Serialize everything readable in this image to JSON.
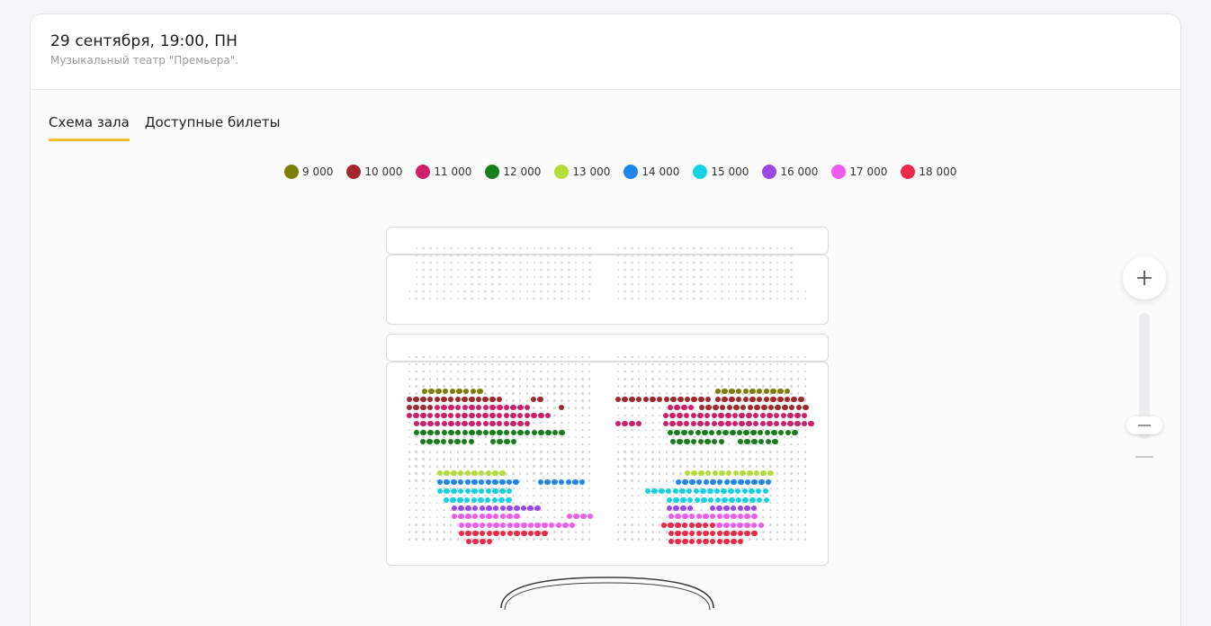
{
  "event": {
    "title": "29 сентября, 19:00, ПН",
    "venue": "Музыкальный театр \"Премьера\"."
  },
  "tabs": [
    {
      "label": "Схема зала",
      "active": true
    },
    {
      "label": "Доступные билеты",
      "active": false
    }
  ],
  "legend": [
    {
      "label": "9 000",
      "color": "#7d7d0a"
    },
    {
      "label": "10 000",
      "color": "#a3282c"
    },
    {
      "label": "11 000",
      "color": "#cf1f6a"
    },
    {
      "label": "12 000",
      "color": "#177e1b"
    },
    {
      "label": "13 000",
      "color": "#b3de3a"
    },
    {
      "label": "14 000",
      "color": "#1e86e8"
    },
    {
      "label": "15 000",
      "color": "#14d2e6"
    },
    {
      "label": "16 000",
      "color": "#9c47e6"
    },
    {
      "label": "17 000",
      "color": "#ef5bef"
    },
    {
      "label": "18 000",
      "color": "#e82a48"
    }
  ],
  "icons": {
    "zoom_in": "plus-icon",
    "zoom_out": "minus-icon",
    "slider": "slider-thumb"
  },
  "colors": {
    "accent": "#f5c029",
    "unavailable_seat": "#d6d6da"
  }
}
